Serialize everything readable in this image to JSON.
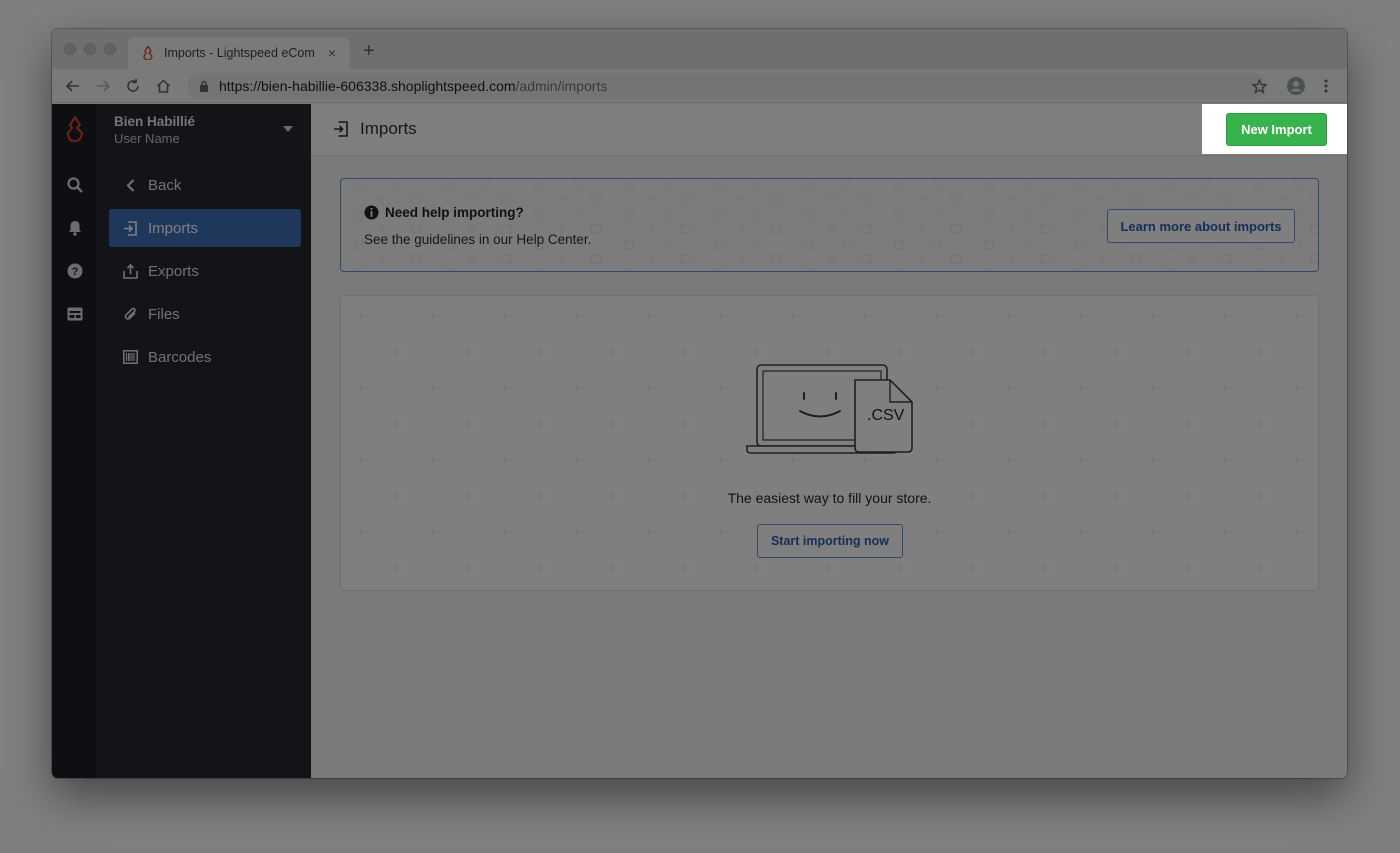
{
  "browser": {
    "tab_title": "Imports - Lightspeed eCom",
    "tab_close": "×",
    "new_tab": "+",
    "url_host": "https://bien-habillie-606338.shoplightspeed.com",
    "url_path": "/admin/imports"
  },
  "store": {
    "name": "Bien Habillié",
    "user": "User Name"
  },
  "rail": {
    "icons": [
      "search-icon",
      "bell-icon",
      "help-icon",
      "store-icon"
    ]
  },
  "menu": {
    "back_label": "Back",
    "items": [
      {
        "label": "Imports",
        "icon": "import-icon",
        "active": true
      },
      {
        "label": "Exports",
        "icon": "export-icon",
        "active": false
      },
      {
        "label": "Files",
        "icon": "paperclip-icon",
        "active": false
      },
      {
        "label": "Barcodes",
        "icon": "barcode-icon",
        "active": false
      }
    ]
  },
  "header": {
    "title": "Imports",
    "new_import_label": "New Import"
  },
  "help": {
    "title": "Need help importing?",
    "text": "See the guidelines in our Help Center.",
    "button_label": "Learn more about imports"
  },
  "empty": {
    "csv_label": ".CSV",
    "text": "The easiest way to fill your store.",
    "button_label": "Start importing now"
  },
  "colors": {
    "accent_green": "#37b24d",
    "accent_blue": "#3e6fb4",
    "sidebar_bg": "#24292f",
    "rail_bg": "#1b1f24"
  }
}
